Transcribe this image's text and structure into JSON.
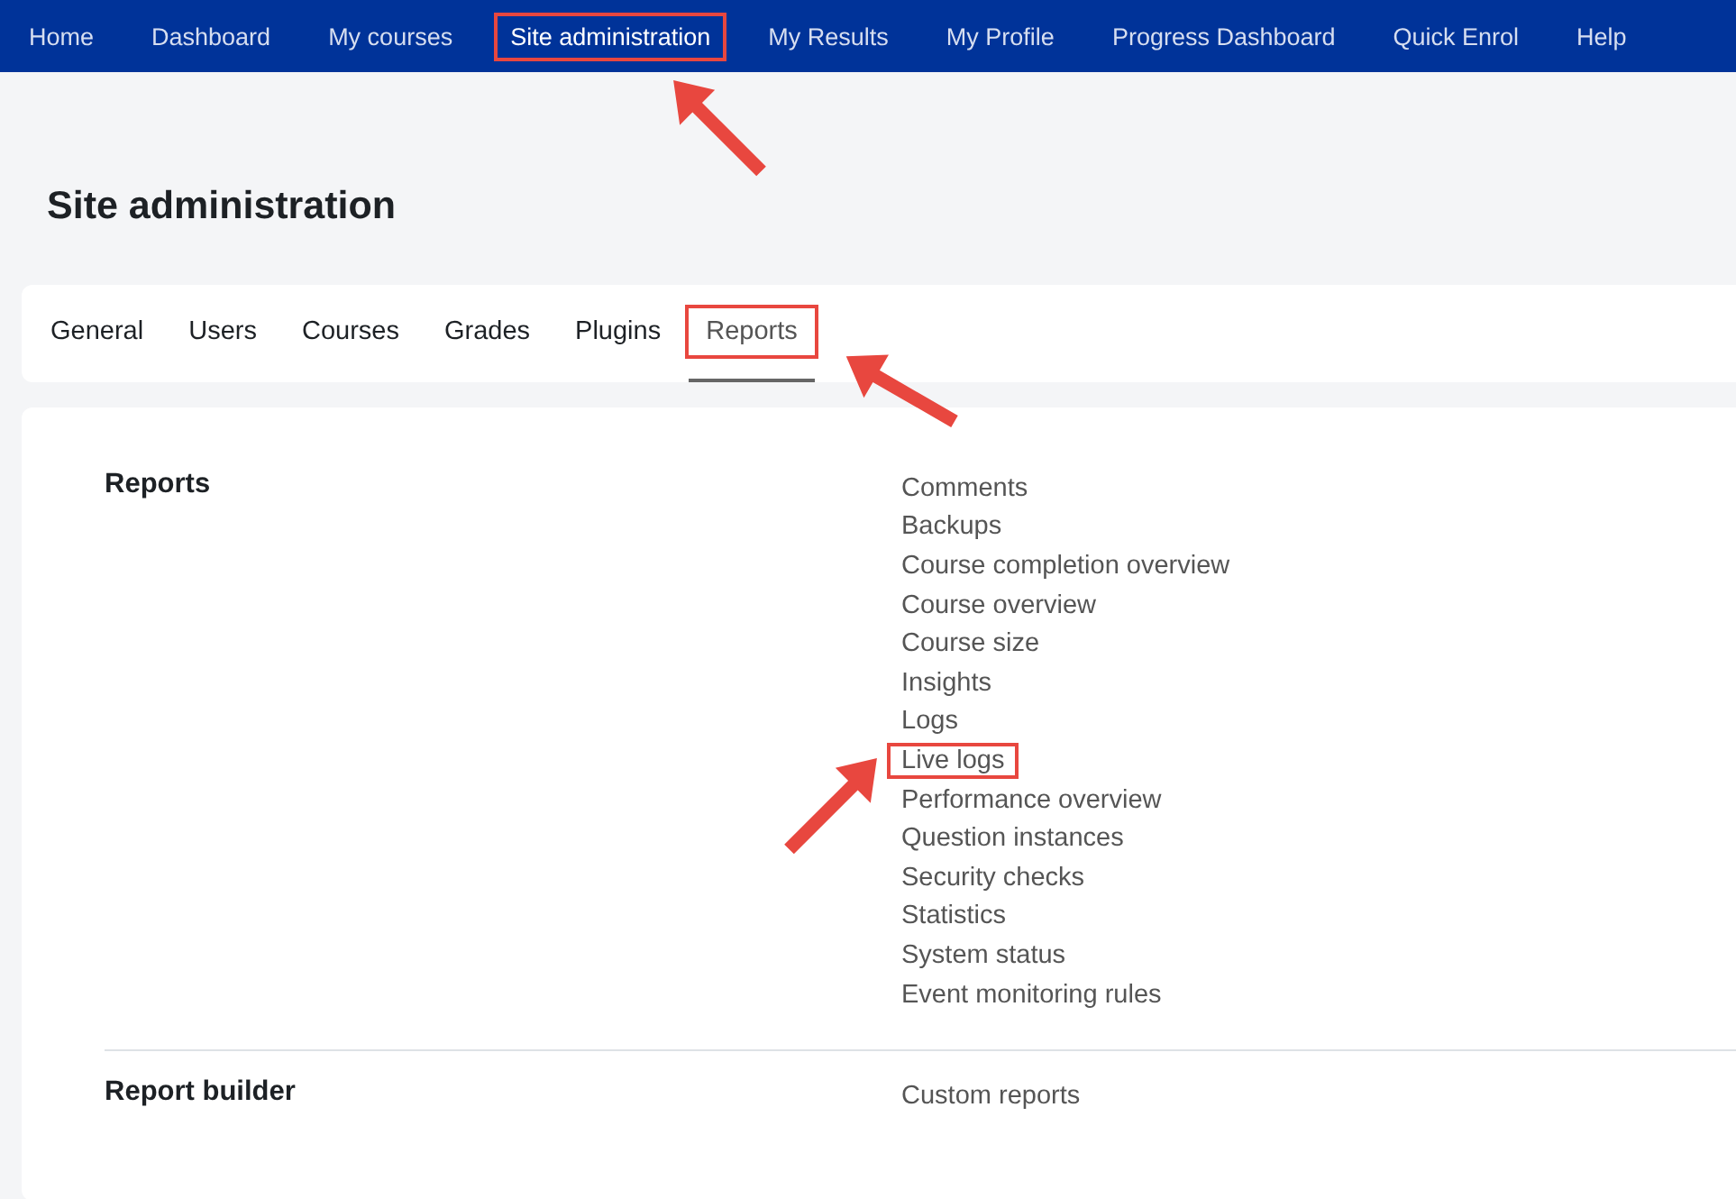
{
  "nav": [
    {
      "label": "Home",
      "highlighted": false
    },
    {
      "label": "Dashboard",
      "highlighted": false
    },
    {
      "label": "My courses",
      "highlighted": false
    },
    {
      "label": "Site administration",
      "highlighted": true,
      "arrow": true
    },
    {
      "label": "My Results",
      "highlighted": false
    },
    {
      "label": "My Profile",
      "highlighted": false
    },
    {
      "label": "Progress Dashboard",
      "highlighted": false
    },
    {
      "label": "Quick Enrol",
      "highlighted": false
    },
    {
      "label": "Help",
      "highlighted": false
    }
  ],
  "page_title": "Site administration",
  "tabs": [
    {
      "label": "General",
      "selected": false,
      "highlighted": false
    },
    {
      "label": "Users",
      "selected": false,
      "highlighted": false
    },
    {
      "label": "Courses",
      "selected": false,
      "highlighted": false
    },
    {
      "label": "Grades",
      "selected": false,
      "highlighted": false
    },
    {
      "label": "Plugins",
      "selected": false,
      "highlighted": false
    },
    {
      "label": "Reports",
      "selected": true,
      "highlighted": true,
      "arrow": true
    }
  ],
  "sections": [
    {
      "heading": "Reports",
      "links": [
        {
          "label": "Comments",
          "highlighted": false
        },
        {
          "label": "Backups",
          "highlighted": false
        },
        {
          "label": "Course completion overview",
          "highlighted": false
        },
        {
          "label": "Course overview",
          "highlighted": false
        },
        {
          "label": "Course size",
          "highlighted": false
        },
        {
          "label": "Insights",
          "highlighted": false
        },
        {
          "label": "Logs",
          "highlighted": false
        },
        {
          "label": "Live logs",
          "highlighted": true,
          "arrow": true
        },
        {
          "label": "Performance overview",
          "highlighted": false
        },
        {
          "label": "Question instances",
          "highlighted": false
        },
        {
          "label": "Security checks",
          "highlighted": false
        },
        {
          "label": "Statistics",
          "highlighted": false
        },
        {
          "label": "System status",
          "highlighted": false
        },
        {
          "label": "Event monitoring rules",
          "highlighted": false
        }
      ]
    },
    {
      "heading": "Report builder",
      "links": [
        {
          "label": "Custom reports",
          "highlighted": false
        }
      ]
    }
  ]
}
